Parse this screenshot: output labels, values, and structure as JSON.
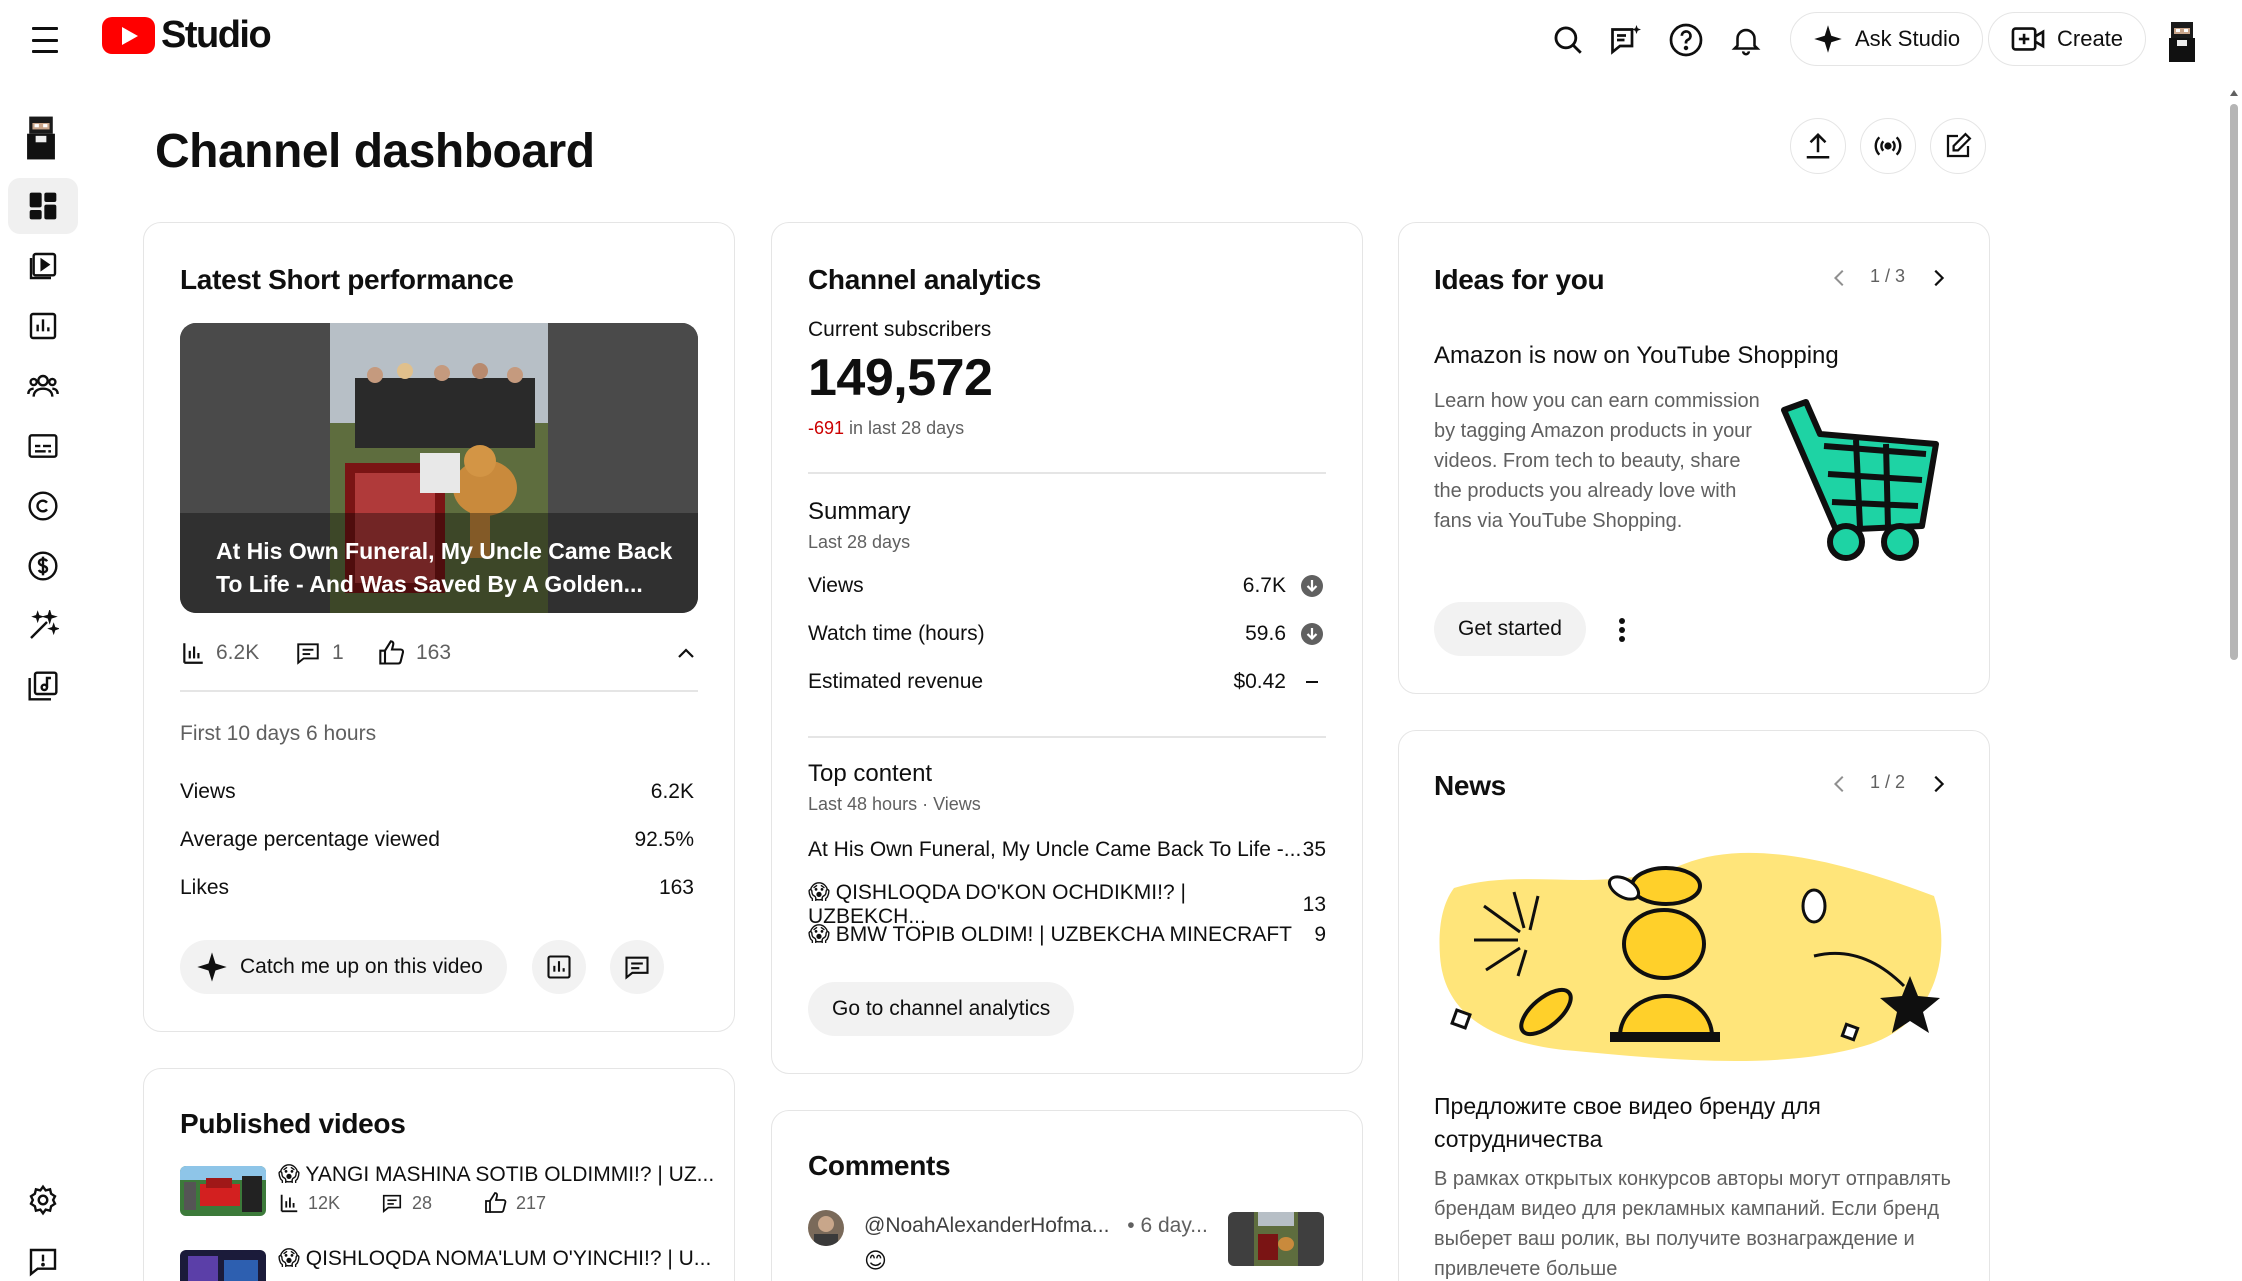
{
  "app": {
    "name": "Studio"
  },
  "topbar": {
    "ask_label": "Ask Studio",
    "create_label": "Create"
  },
  "page": {
    "title": "Channel dashboard"
  },
  "short_card": {
    "title": "Latest Short performance",
    "video_title": "At His Own Funeral, My Uncle Came Back To Life - And Was Saved By A Golden...",
    "stats": {
      "views": "6.2K",
      "comments": "1",
      "likes": "163"
    },
    "period": "First 10 days 6 hours",
    "rows": [
      {
        "label": "Views",
        "value": "6.2K"
      },
      {
        "label": "Average percentage viewed",
        "value": "92.5%"
      },
      {
        "label": "Likes",
        "value": "163"
      }
    ],
    "catch_label": "Catch me up on this video"
  },
  "published": {
    "title": "Published videos",
    "videos": [
      {
        "emoji": "😱",
        "title": "YANGI MASHINA SOTIB OLDIMMI!? | UZ...",
        "views": "12K",
        "comments": "28",
        "likes": "217"
      },
      {
        "emoji": "😱",
        "title": "QISHLOQDA NOMA'LUM O'YINCHI!? | U..."
      }
    ]
  },
  "analytics": {
    "title": "Channel analytics",
    "subs_label": "Current subscribers",
    "subs_value": "149,572",
    "subs_change": "-691",
    "subs_period": " in last 28 days",
    "summary_title": "Summary",
    "summary_period": "Last 28 days",
    "summary_rows": [
      {
        "label": "Views",
        "value": "6.7K",
        "trend": "down"
      },
      {
        "label": "Watch time (hours)",
        "value": "59.6",
        "trend": "down"
      },
      {
        "label": "Estimated revenue",
        "value": "$0.42",
        "trend": "flat"
      }
    ],
    "top_title": "Top content",
    "top_period": "Last 48 hours · Views",
    "top_rows": [
      {
        "emoji": "",
        "title": "At His Own Funeral, My Uncle Came Back To Life -...",
        "value": "35"
      },
      {
        "emoji": "😱",
        "title": "QISHLOQDA DO'KON OCHDIKMI!? | UZBEKCH...",
        "value": "13"
      },
      {
        "emoji": "😱",
        "title": "BMW TOPIB OLDIM! | UZBEKCHA MINECRAFT",
        "value": "9"
      }
    ],
    "go_label": "Go to channel analytics"
  },
  "comments": {
    "title": "Comments",
    "items": [
      {
        "author": "@NoahAlexanderHofma...",
        "time": "• 6 day...",
        "text": "😊"
      }
    ]
  },
  "ideas": {
    "title": "Ideas for you",
    "pager": "1 / 3",
    "heading": "Amazon is now on YouTube Shopping",
    "body": "Learn how you can earn commission by tagging Amazon products in your videos. From tech to beauty, share the products you already love with fans via YouTube Shopping.",
    "cta": "Get started"
  },
  "news": {
    "title": "News",
    "pager": "1 / 2",
    "heading": "Предложите свое видео бренду для сотрудничества",
    "body": "В рамках открытых конкурсов авторы могут отправлять брендам видео для рекламных кампаний. Если бренд выберет ваш ролик, вы получите вознаграждение и привлечете больше"
  },
  "colors": {
    "brand_red": "#ff0000",
    "negative": "#cc0000",
    "cart_green": "#1ed3a4",
    "news_yellow": "#ffe57a"
  }
}
